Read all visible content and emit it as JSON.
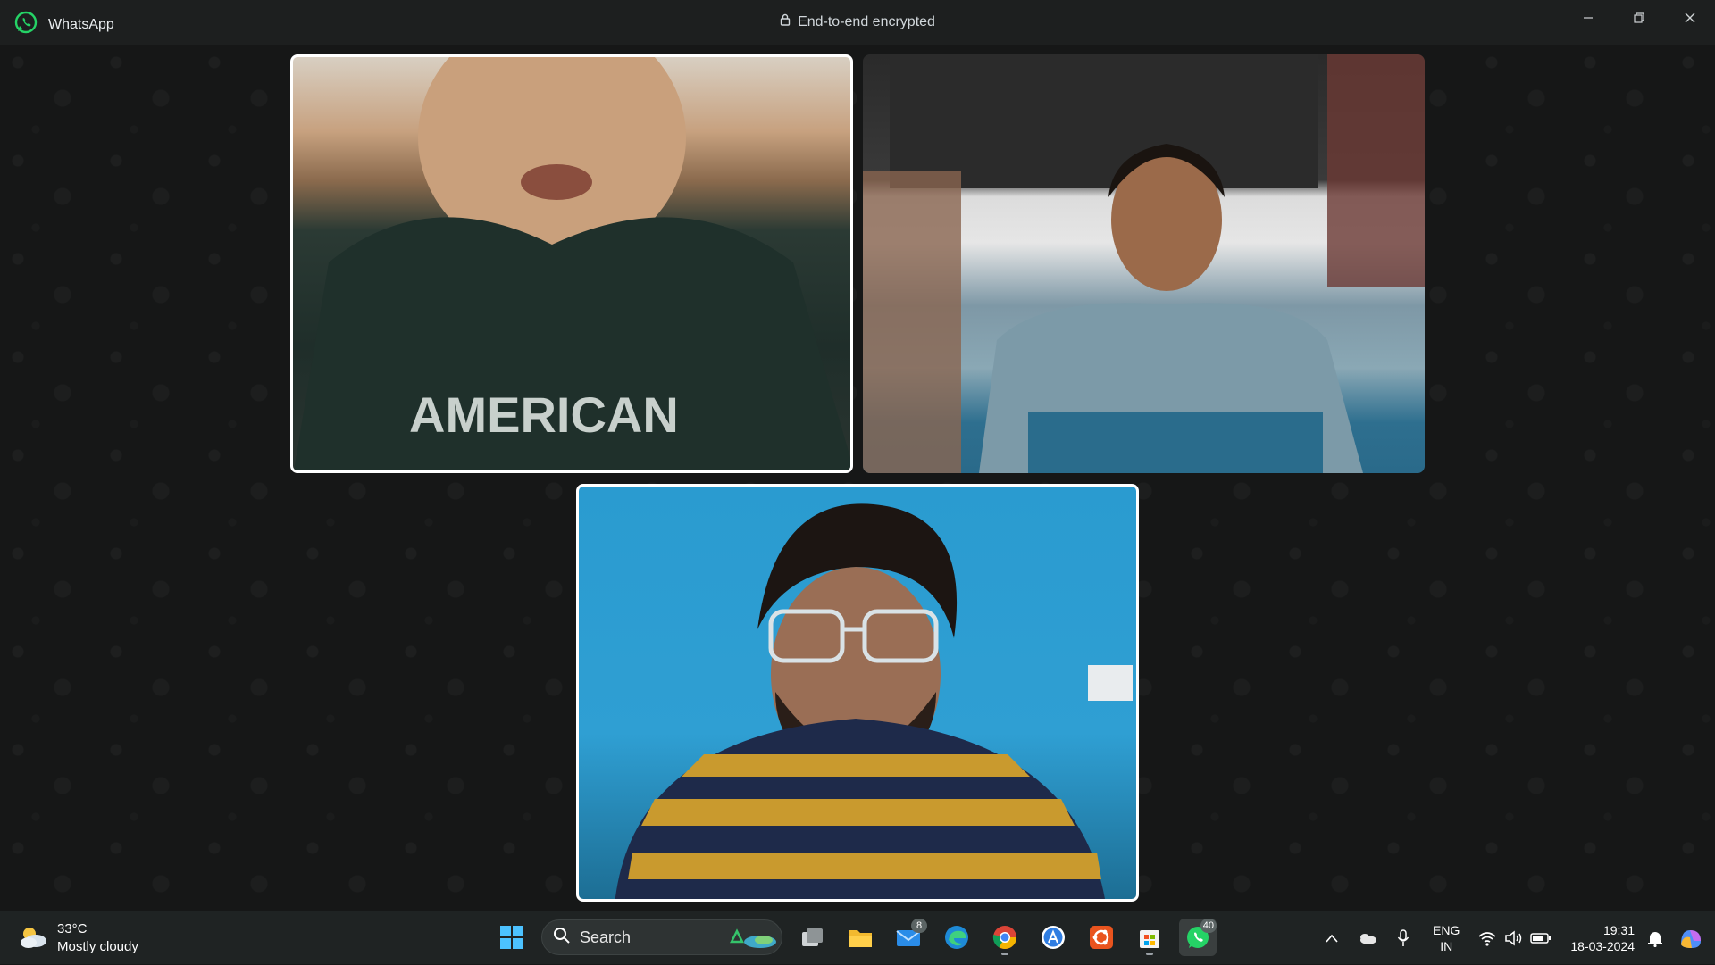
{
  "window": {
    "app_name": "WhatsApp",
    "status": "End-to-end encrypted",
    "brand_color": "#25D366"
  },
  "call": {
    "participants": [
      {
        "tile": "participant-video-1",
        "shirt_text": "AMERICAN",
        "active_speaker": true
      },
      {
        "tile": "participant-video-2",
        "active_speaker": false
      },
      {
        "tile": "participant-video-3-self",
        "active_speaker": true
      }
    ]
  },
  "taskbar": {
    "weather": {
      "temperature": "33°C",
      "condition": "Mostly cloudy",
      "icon": "partly-cloudy-icon"
    },
    "search_label": "Search",
    "apps": [
      {
        "name": "windows-start-icon"
      },
      {
        "name": "task-view-icon"
      },
      {
        "name": "file-explorer-icon"
      },
      {
        "name": "mail-icon",
        "badge": "8"
      },
      {
        "name": "edge-icon"
      },
      {
        "name": "chrome-icon"
      },
      {
        "name": "app-store-icon"
      },
      {
        "name": "ubuntu-icon"
      },
      {
        "name": "microsoft-store-icon"
      },
      {
        "name": "whatsapp-icon",
        "badge": "40"
      }
    ],
    "language": {
      "line1": "ENG",
      "line2": "IN"
    },
    "clock": {
      "time": "19:31",
      "date": "18-03-2024"
    }
  }
}
